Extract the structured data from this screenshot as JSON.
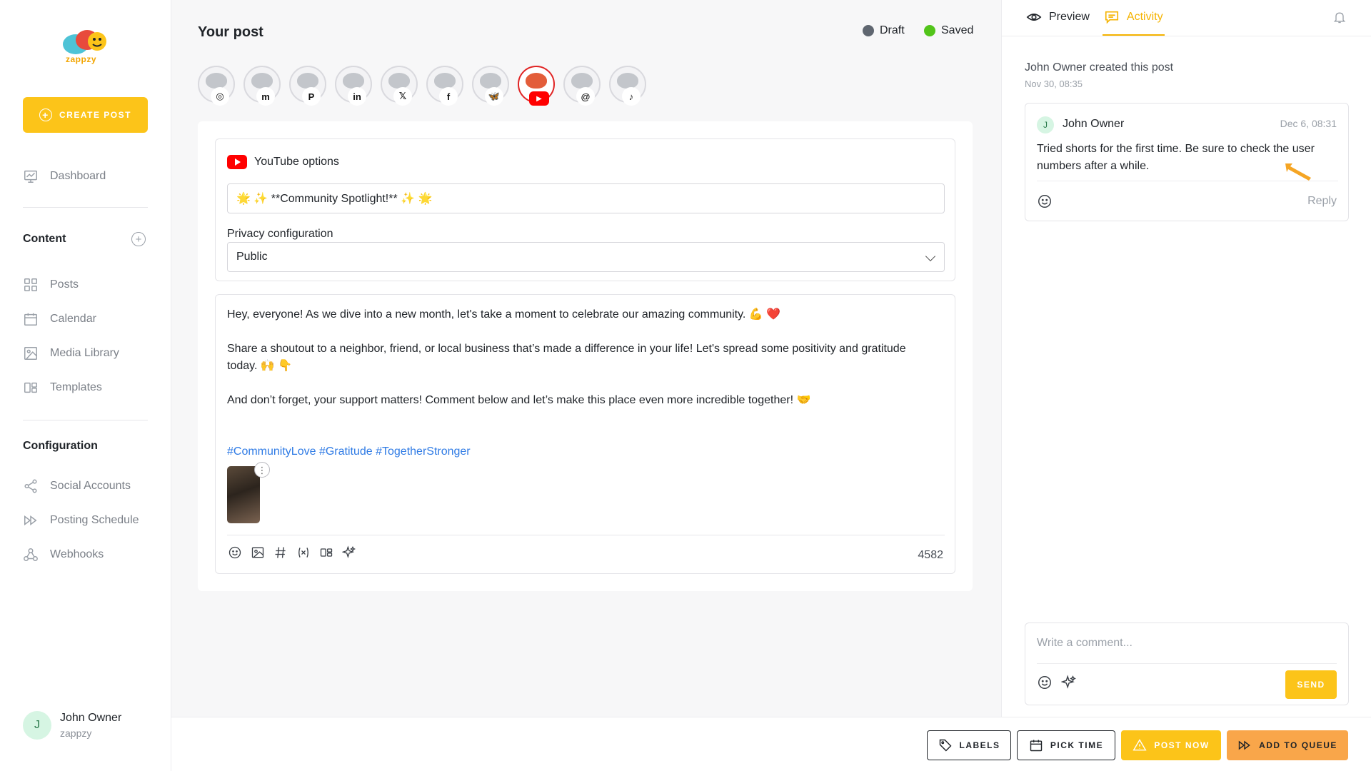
{
  "brand": {
    "name": "zappzy",
    "accent": "#fcc419"
  },
  "sidebar": {
    "create_label": "CREATE POST",
    "dashboard": "Dashboard",
    "content_title": "Content",
    "content_items": [
      "Posts",
      "Calendar",
      "Media Library",
      "Templates"
    ],
    "config_title": "Configuration",
    "config_items": [
      "Social Accounts",
      "Posting Schedule",
      "Webhooks"
    ],
    "user": {
      "initial": "J",
      "name": "John Owner",
      "org": "zappzy"
    }
  },
  "post": {
    "title": "Your post",
    "status_draft": "Draft",
    "status_saved": "Saved",
    "draft_color": "#5f6670",
    "saved_color": "#52c41a",
    "channels": [
      {
        "network": "instagram",
        "glyph": "◎",
        "active": false
      },
      {
        "network": "mastodon",
        "glyph": "m",
        "active": false
      },
      {
        "network": "pinterest",
        "glyph": "P",
        "active": false
      },
      {
        "network": "linkedin",
        "glyph": "in",
        "active": false
      },
      {
        "network": "x",
        "glyph": "𝕏",
        "active": false
      },
      {
        "network": "facebook",
        "glyph": "f",
        "active": false
      },
      {
        "network": "bluesky",
        "glyph": "🦋",
        "active": false
      },
      {
        "network": "youtube",
        "glyph": "▶",
        "active": true
      },
      {
        "network": "threads",
        "glyph": "@",
        "active": false
      },
      {
        "network": "tiktok",
        "glyph": "♪",
        "active": false
      }
    ],
    "youtube": {
      "header": "YouTube options",
      "title_value": "🌟 ✨ **Community Spotlight!** ✨ 🌟",
      "privacy_label": "Privacy configuration",
      "privacy_value": "Public"
    },
    "body": {
      "p1": "Hey, everyone! As we dive into a new month, let's take a moment to celebrate our amazing community. 💪 ❤️",
      "p2": "Share a shoutout to a neighbor, friend, or local business that’s made a difference in your life! Let's spread some positivity and gratitude today. 🙌 👇",
      "p3": "And don’t forget, your support matters! Comment below and let’s make this place even more incredible together! 🤝",
      "hashtags": "#CommunityLove #Gratitude #TogetherStronger"
    },
    "char_count": "4582"
  },
  "panel": {
    "tab_preview": "Preview",
    "tab_activity": "Activity",
    "created_text": "John Owner created this post",
    "created_date": "Nov 30, 08:35",
    "comment": {
      "initial": "J",
      "author": "John Owner",
      "date": "Dec 6, 08:31",
      "text": "Tried shorts for the first time. Be sure to check the user numbers after a while.",
      "reply_label": "Reply"
    },
    "compose_placeholder": "Write a comment...",
    "send_label": "SEND"
  },
  "actions": {
    "labels": "LABELS",
    "pick_time": "PICK TIME",
    "post_now": "POST NOW",
    "add_to_queue": "ADD TO QUEUE"
  }
}
